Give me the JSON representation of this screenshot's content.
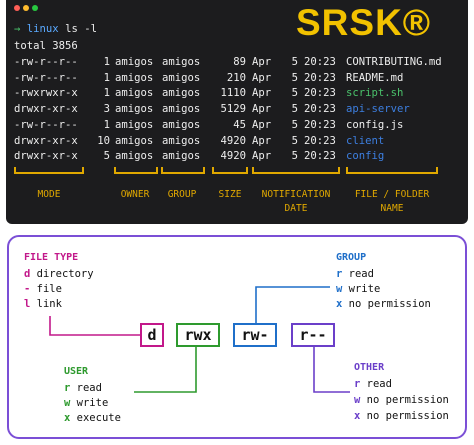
{
  "logo": "SRSK®",
  "terminal": {
    "prompt_arrow": "→",
    "prompt_dir": "linux",
    "command": "ls -l",
    "total": "total 3856",
    "rows": [
      {
        "perm": "-rw-r--r--",
        "links": "1",
        "owner": "amigos",
        "group": "amigos",
        "size": "89",
        "month": "Apr",
        "day": "5",
        "time": "20:23",
        "name": "CONTRIBUTING.md",
        "color": "#eeeeee"
      },
      {
        "perm": "-rw-r--r--",
        "links": "1",
        "owner": "amigos",
        "group": "amigos",
        "size": "210",
        "month": "Apr",
        "day": "5",
        "time": "20:23",
        "name": "README.md",
        "color": "#eeeeee"
      },
      {
        "perm": "-rwxrwxr-x",
        "links": "1",
        "owner": "amigos",
        "group": "amigos",
        "size": "1110",
        "month": "Apr",
        "day": "5",
        "time": "20:23",
        "name": "script.sh",
        "color": "#4ac26b"
      },
      {
        "perm": "drwxr-xr-x",
        "links": "3",
        "owner": "amigos",
        "group": "amigos",
        "size": "5129",
        "month": "Apr",
        "day": "5",
        "time": "20:23",
        "name": "api-server",
        "color": "#3d7fe0"
      },
      {
        "perm": "-rw-r--r--",
        "links": "1",
        "owner": "amigos",
        "group": "amigos",
        "size": "45",
        "month": "Apr",
        "day": "5",
        "time": "20:23",
        "name": "config.js",
        "color": "#eeeeee"
      },
      {
        "perm": "drwxr-xr-x",
        "links": "10",
        "owner": "amigos",
        "group": "amigos",
        "size": "4920",
        "month": "Apr",
        "day": "5",
        "time": "20:23",
        "name": "client",
        "color": "#3d7fe0"
      },
      {
        "perm": "drwxr-xr-x",
        "links": "5",
        "owner": "amigos",
        "group": "amigos",
        "size": "4920",
        "month": "Apr",
        "day": "5",
        "time": "20:23",
        "name": "config",
        "color": "#3d7fe0"
      }
    ],
    "labels": {
      "mode": "MODE",
      "owner": "OWNER",
      "group": "GROUP",
      "size": "SIZE",
      "notification": "NOTIFICATION",
      "date": "DATE",
      "file_folder": "FILE / FOLDER",
      "name": "NAME"
    }
  },
  "diagram": {
    "file_type": {
      "title": "FILE TYPE",
      "items": [
        {
          "key": "d",
          "text": "directory"
        },
        {
          "key": "-",
          "text": "file"
        },
        {
          "key": "l",
          "text": "link"
        }
      ]
    },
    "group": {
      "title": "GROUP",
      "items": [
        {
          "key": "r",
          "text": "read"
        },
        {
          "key": "w",
          "text": "write"
        },
        {
          "key": "x",
          "text": "no permission"
        }
      ]
    },
    "user": {
      "title": "USER",
      "items": [
        {
          "key": "r",
          "text": "read"
        },
        {
          "key": "w",
          "text": "write"
        },
        {
          "key": "x",
          "text": "execute"
        }
      ]
    },
    "other": {
      "title": "OTHER",
      "items": [
        {
          "key": "r",
          "text": "read"
        },
        {
          "key": "w",
          "text": "no permission"
        },
        {
          "key": "x",
          "text": "no permission"
        }
      ]
    },
    "boxes": {
      "type": "d",
      "user": "rwx",
      "group": "rw-",
      "other": "r--"
    }
  },
  "colors": {
    "accent_yellow": "#e0a800",
    "logo_yellow": "#f2c200",
    "terminal_bg": "#1c1c1e",
    "panel_border": "#7b4fd6",
    "file_type_pink": "#c2188a",
    "user_green": "#2e9a2e",
    "group_blue": "#1f6fc9",
    "other_purple": "#6b3fc9"
  }
}
